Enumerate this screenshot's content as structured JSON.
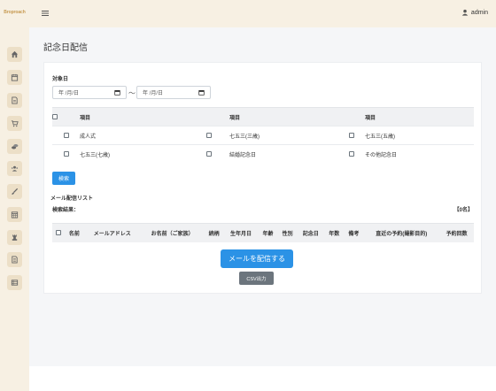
{
  "brand": "Broproach",
  "user": {
    "name": "admin"
  },
  "sidebar": {
    "icons": [
      "home-icon",
      "calendar-icon",
      "document-icon",
      "cart-icon",
      "coins-icon",
      "users-icon",
      "brush-icon",
      "calendar-grid-icon",
      "chess-rook-icon",
      "document-text-icon",
      "list-icon"
    ]
  },
  "page": {
    "title": "記念日配信"
  },
  "filter": {
    "date_label": "対象日",
    "date_from_placeholder": "年 /月/日",
    "date_to_placeholder": "年 /月/日",
    "tilde": "〜"
  },
  "items_table": {
    "header": [
      "項目",
      "項目",
      "項目"
    ],
    "rows": [
      [
        "成人式",
        "七五三(三歳)",
        "七五三(五歳)"
      ],
      [
        "七五三(七歳)",
        "結婚記念日",
        "その他記念日"
      ]
    ]
  },
  "search_button": "検索",
  "mail_list": {
    "title": "メール配信リスト",
    "result_label": "検索結果：",
    "count": "【0名】",
    "columns": [
      "名前",
      "メールアドレス",
      "お名前（ご家族）",
      "続柄",
      "生年月日",
      "年齢",
      "性別",
      "記念日",
      "年数",
      "備考",
      "直近の予約(撮影目的)",
      "予約回数"
    ]
  },
  "send_button": "メールを配信する",
  "csv_button": "CSV出力",
  "colors": {
    "accent": "#2b92e6",
    "sidebar_bg": "#f7f0e3",
    "secondary": "#6c757d"
  }
}
